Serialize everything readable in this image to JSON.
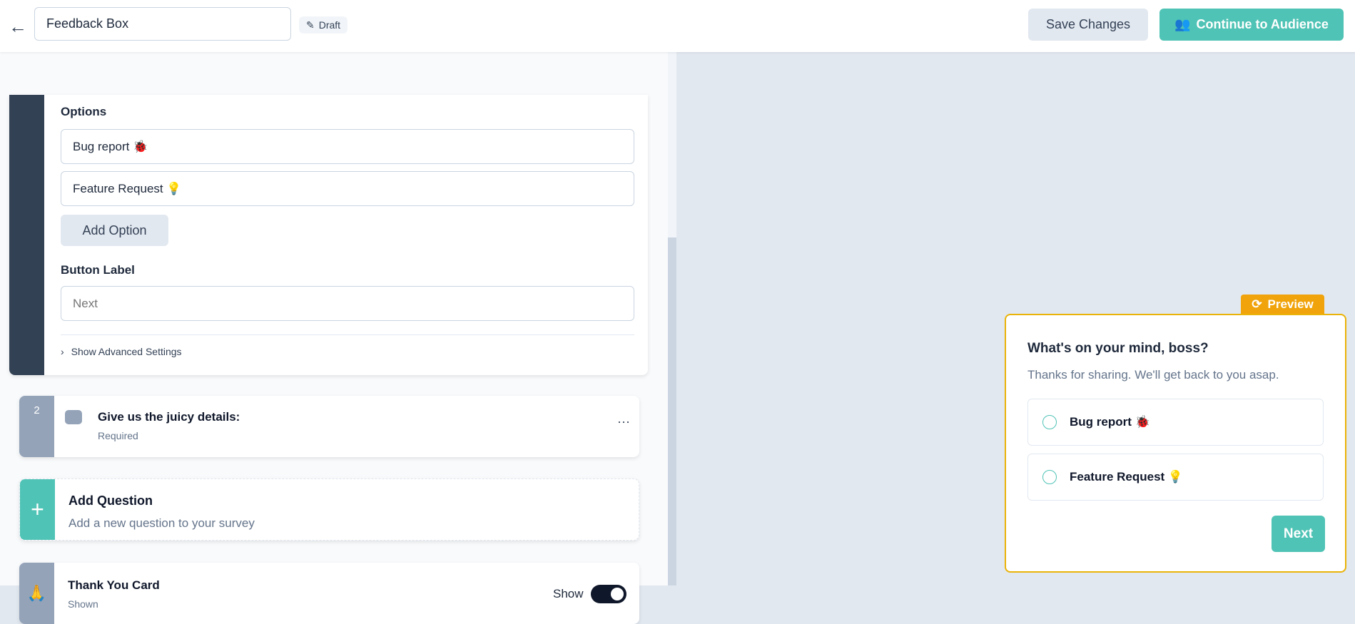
{
  "header": {
    "title": "Feedback Box",
    "status": "Draft",
    "save_label": "Save Changes",
    "continue_label": "Continue to Audience"
  },
  "editor": {
    "options_label": "Options",
    "options": [
      "Bug report 🐞",
      "Feature Request 💡"
    ],
    "add_option_label": "Add Option",
    "button_label_heading": "Button Label",
    "button_label_placeholder": "Next",
    "advanced_label": "Show Advanced Settings",
    "question2": {
      "number": "2",
      "title": "Give us the juicy details:",
      "subtitle": "Required"
    },
    "add_question": {
      "title": "Add Question",
      "subtitle": "Add a new question to your survey"
    },
    "thank_you": {
      "title": "Thank You Card",
      "subtitle": "Shown",
      "toggle_label": "Show",
      "toggle_on": true
    }
  },
  "preview": {
    "badge": "Preview",
    "title": "What's on your mind, boss?",
    "subtitle": "Thanks for sharing. We'll get back to you asap.",
    "options": [
      "Bug report 🐞",
      "Feature Request 💡"
    ],
    "next_label": "Next"
  },
  "colors": {
    "accent": "#4fc3b5",
    "preview_border": "#eab308",
    "preview_badge": "#f0a30a",
    "dark_strip": "#334155"
  }
}
